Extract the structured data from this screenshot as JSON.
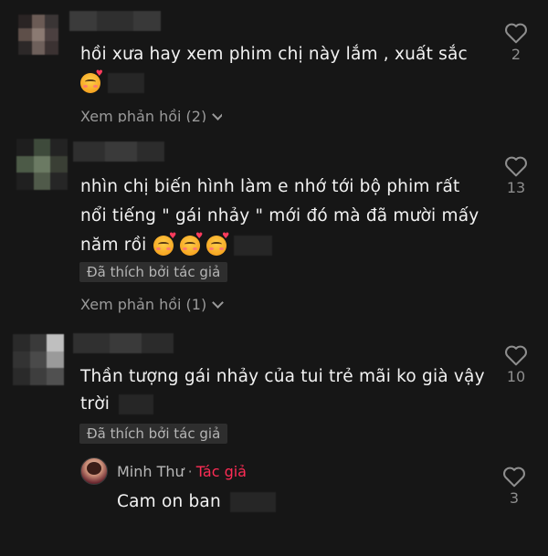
{
  "comments": [
    {
      "text_line1": "hồi xưa hay xem phim chị này lắm , xuất sắc",
      "emoji_count": 1,
      "view_replies_label": "Xem phản hồi (2)",
      "like_count": "2"
    },
    {
      "text_line1": "nhìn chị biến hình làm e nhớ tới bộ phim rất",
      "text_line2": "nổi tiếng \" gái nhảy \" mới đó mà đã mười mấy",
      "text_line3": "năm rồi",
      "emoji_count": 3,
      "liked_by_author_label": "Đã thích bởi tác giả",
      "view_replies_label": "Xem phản hồi (1)",
      "like_count": "13"
    },
    {
      "text_line1": "Thần tượng gái nhảy của tui trẻ mãi ko già vậy",
      "text_line2": "trời",
      "liked_by_author_label": "Đã thích bởi tác giả",
      "like_count": "10"
    }
  ],
  "reply": {
    "username": "Minh Thư",
    "separator": "·",
    "author_tag": "Tác giả",
    "text": "Cam on ban",
    "like_count": "3"
  },
  "icons": {
    "like": "heart-outline-icon",
    "expand": "chevron-down-icon",
    "emoji": "smiling-face-with-hearts-icon"
  },
  "colors": {
    "background": "#161616",
    "text": "#f2f2f2",
    "muted": "#9a9a9a",
    "author_tag": "#fe2c55",
    "badge_bg": "#2e2e2e"
  }
}
